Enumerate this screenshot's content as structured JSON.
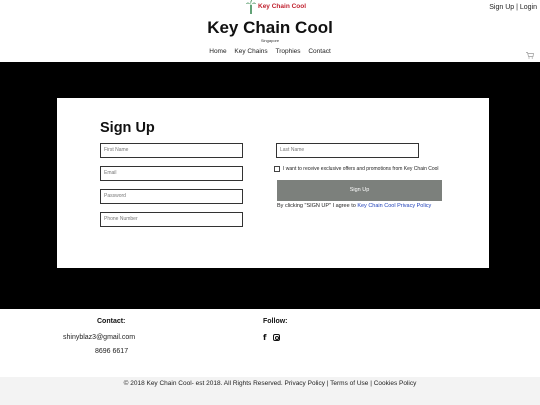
{
  "header": {
    "logo_text": "Key Chain Cool",
    "auth_signup": "Sign Up",
    "auth_separator": " | ",
    "auth_login": "Login",
    "site_title": "Key Chain Cool",
    "site_subtitle": "Singapore",
    "nav": [
      "Home",
      "Key Chains",
      "Trophies",
      "Contact"
    ],
    "cart_icon": "cart-icon"
  },
  "signup": {
    "title": "Sign Up",
    "first_name_placeholder": "First Name",
    "last_name_placeholder": "Last Name",
    "email_placeholder": "Email",
    "password_placeholder": "Password",
    "phone_placeholder": "Phone Number",
    "optin_label": "I want to receive exclusive offers and promotions from Key Chain Cool",
    "button_label": "Sign Up",
    "terms_text": "By clicking \"SIGN UP\" I agree to ",
    "terms_link": "Key Chain Cool Privacy Policy"
  },
  "footer": {
    "contact_title": "Contact:",
    "email": "shinyblaz3@gmail.com",
    "phone": "8696 6617",
    "follow_title": "Follow:",
    "social_icons": [
      "facebook-icon",
      "instagram-icon"
    ],
    "copyright": "© 2018 Key Chain Cool- est 2018. All Rights Reserved. Privacy Policy | Terms of Use | Cookies Policy"
  },
  "colors": {
    "hero_bg": "#000000",
    "button_bg": "#7c807c",
    "link": "#1e3fb8",
    "logo_red": "#c0202e",
    "logo_green": "#1f7a3a"
  }
}
